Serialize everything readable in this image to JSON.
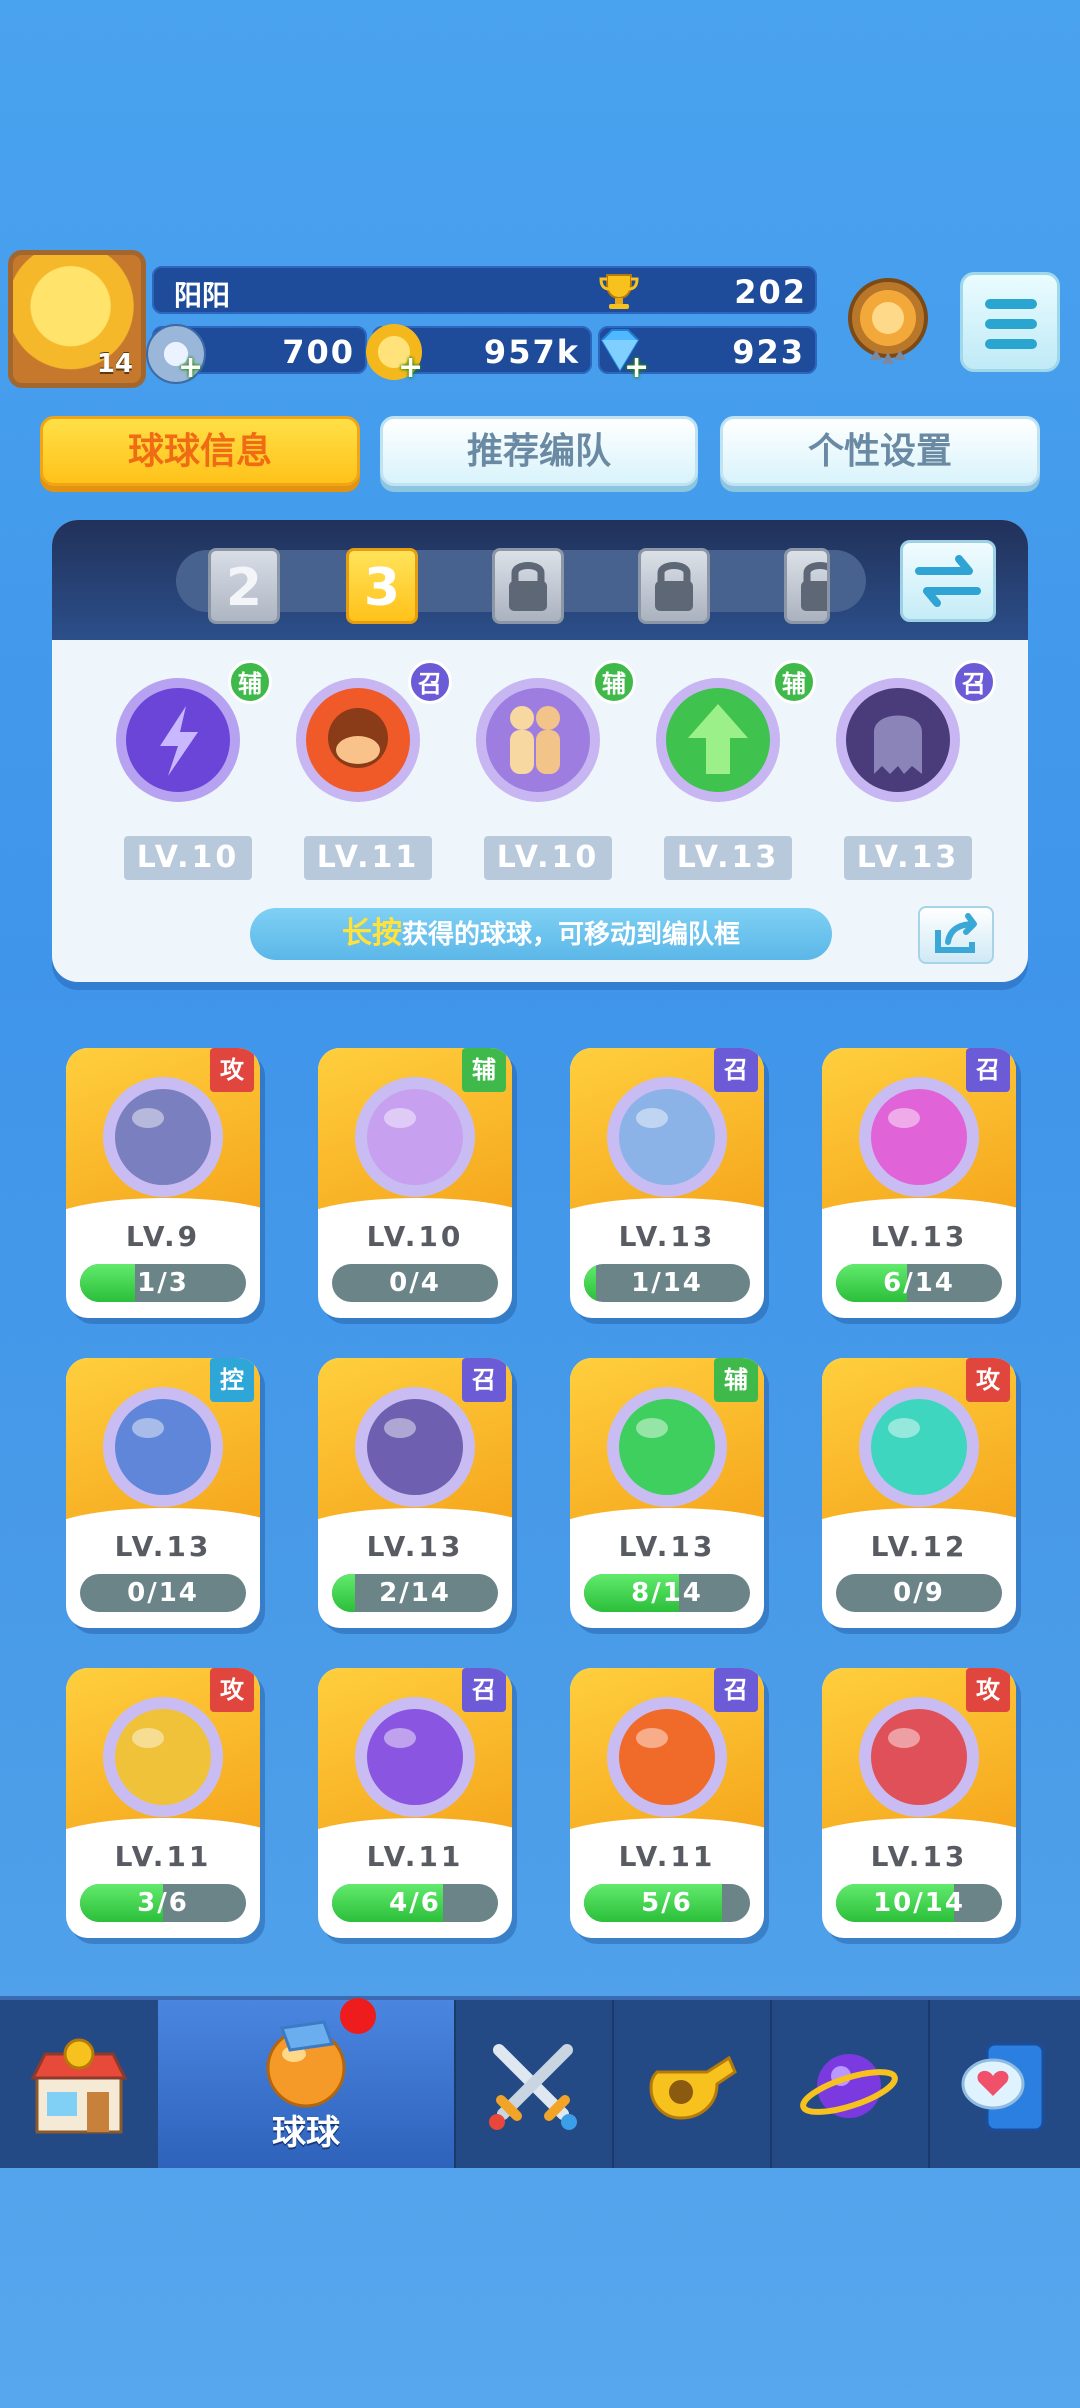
{
  "header": {
    "player_name": "阳阳",
    "player_level": "14",
    "trophies": "202",
    "stamina": "700",
    "coins": "957k",
    "gems": "923"
  },
  "tabs": {
    "ball_info": "球球信息",
    "recommended_team": "推荐编队",
    "personal_settings": "个性设置"
  },
  "team": {
    "slots": [
      "2",
      "3"
    ],
    "active_slot": "3",
    "balls": [
      {
        "tag": "辅",
        "level": "LV.10",
        "icon": "lightning-ball-icon"
      },
      {
        "tag": "召",
        "level": "LV.11",
        "icon": "monkey-ball-icon"
      },
      {
        "tag": "辅",
        "level": "LV.10",
        "icon": "crowd-ball-icon"
      },
      {
        "tag": "辅",
        "level": "LV.13",
        "icon": "arrow-up-ball-icon"
      },
      {
        "tag": "召",
        "level": "LV.13",
        "icon": "ghost-ball-icon"
      }
    ],
    "hint_highlight": "长按",
    "hint_text": "获得的球球，可移动到编队框"
  },
  "balls": [
    {
      "tag": "攻",
      "level": "LV.9",
      "progress": "1/3",
      "fill": 0.33,
      "color": "#7a7fc0"
    },
    {
      "tag": "辅",
      "level": "LV.10",
      "progress": "0/4",
      "fill": 0,
      "color": "#c7a0f0"
    },
    {
      "tag": "召",
      "level": "LV.13",
      "progress": "1/14",
      "fill": 0.07,
      "color": "#8cb3e8"
    },
    {
      "tag": "召",
      "level": "LV.13",
      "progress": "6/14",
      "fill": 0.43,
      "color": "#e064d8"
    },
    {
      "tag": "控",
      "level": "LV.13",
      "progress": "0/14",
      "fill": 0,
      "color": "#5f86d8"
    },
    {
      "tag": "召",
      "level": "LV.13",
      "progress": "2/14",
      "fill": 0.14,
      "color": "#6e5fb0"
    },
    {
      "tag": "辅",
      "level": "LV.13",
      "progress": "8/14",
      "fill": 0.57,
      "color": "#3fcf5e"
    },
    {
      "tag": "攻",
      "level": "LV.12",
      "progress": "0/9",
      "fill": 0,
      "color": "#3fd6c0"
    },
    {
      "tag": "攻",
      "level": "LV.11",
      "progress": "3/6",
      "fill": 0.5,
      "color": "#f0c23a"
    },
    {
      "tag": "召",
      "level": "LV.11",
      "progress": "4/6",
      "fill": 0.67,
      "color": "#8a55e0"
    },
    {
      "tag": "召",
      "level": "LV.11",
      "progress": "5/6",
      "fill": 0.83,
      "color": "#f06a2a"
    },
    {
      "tag": "攻",
      "level": "LV.13",
      "progress": "10/14",
      "fill": 0.71,
      "color": "#e05058"
    }
  ],
  "nav": {
    "balls_label": "球球",
    "items": [
      "shop-icon",
      "ball-icon",
      "battle-swords-icon",
      "whistle-icon",
      "planet-icon",
      "chat-heart-icon"
    ]
  }
}
